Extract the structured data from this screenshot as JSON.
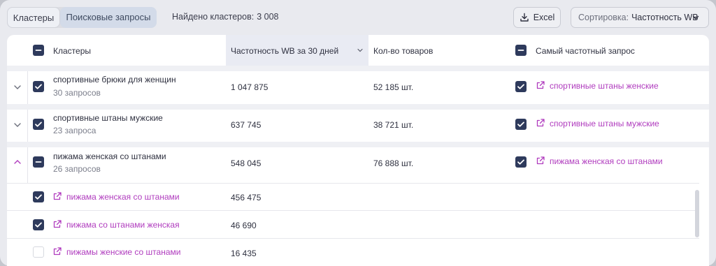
{
  "toolbar": {
    "tab_clusters": "Кластеры",
    "tab_queries": "Поисковые запросы",
    "found_label": "Найдено кластеров:",
    "found_count": "3 008",
    "excel_label": "Excel",
    "sort_label": "Сортировка:",
    "sort_value": "Частотность WB"
  },
  "table": {
    "headers": {
      "clusters": "Кластеры",
      "frequency": "Частотность WB за 30 дней",
      "products": "Кол-во товаров",
      "top_query": "Самый частотный запрос"
    },
    "rows": [
      {
        "name": "спортивные брюки для женщин",
        "queries": "30 запросов",
        "frequency": "1 047 875",
        "products": "52 185 шт.",
        "top_query": "спортивные штаны женские",
        "expanded": false
      },
      {
        "name": "спортивные штаны мужские",
        "queries": "23 запроса",
        "frequency": "637 745",
        "products": "38 721 шт.",
        "top_query": "спортивные штаны мужские",
        "expanded": false
      },
      {
        "name": "пижама женская со штанами",
        "queries": "26 запросов",
        "frequency": "548 045",
        "products": "76 888 шт.",
        "top_query": "пижама женская со штанами",
        "expanded": true
      }
    ],
    "sub_rows": [
      {
        "query": "пижама женская со штанами",
        "frequency": "456 475",
        "checked": true
      },
      {
        "query": "пижама со штанами женская",
        "frequency": "46 690",
        "checked": true
      },
      {
        "query": "пижамы женские со штанами",
        "frequency": "16 435",
        "checked": false
      }
    ]
  },
  "colors": {
    "accent_link": "#b03cbe",
    "checkbox": "#2e3a5c",
    "sorted_header_bg": "#e9ebf3"
  }
}
